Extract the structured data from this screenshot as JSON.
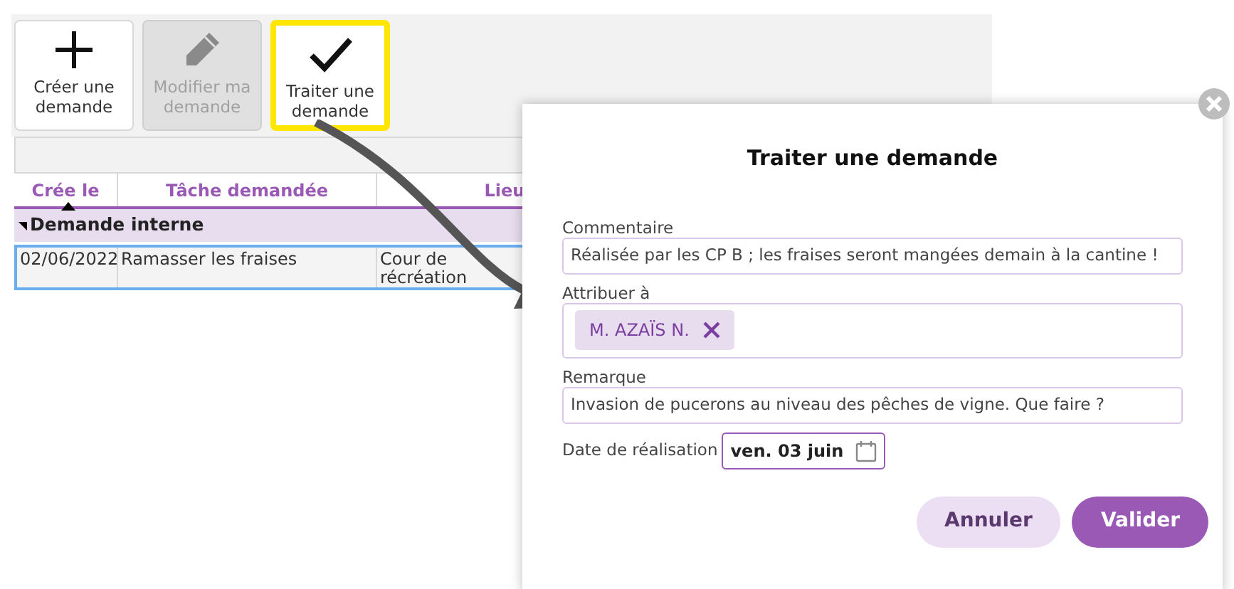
{
  "toolbar": {
    "buttons": [
      {
        "label": "Créer une demande",
        "kind": "plus",
        "disabled": false,
        "highlighted": false
      },
      {
        "label": "Modifier ma demande",
        "kind": "pencil",
        "disabled": true,
        "highlighted": false
      },
      {
        "label": "Traiter une demande",
        "kind": "check",
        "disabled": false,
        "highlighted": true
      }
    ]
  },
  "table": {
    "columns": [
      {
        "label": "Crée le",
        "sorted": true
      },
      {
        "label": "Tâche demandée",
        "sorted": false
      },
      {
        "label": "Lieu",
        "sorted": false
      }
    ],
    "groups": [
      {
        "label": "Demande interne",
        "expanded": true,
        "rows": [
          {
            "cells": [
              "02/06/2022",
              "Ramasser les fraises",
              "Cour de récréation"
            ],
            "selected": true
          }
        ]
      }
    ]
  },
  "dialog": {
    "title": "Traiter une demande",
    "fields": [
      {
        "kind": "text",
        "label": "Commentaire",
        "value": "Réalisée par les CP B ; les fraises seront mangées demain à la cantine !"
      },
      {
        "kind": "tags",
        "label": "Attribuer à",
        "tags": [
          "M. AZAÏS N."
        ]
      },
      {
        "kind": "text",
        "label": "Remarque",
        "value": "Invasion de pucerons au niveau des pêches de vigne. Que faire ?"
      },
      {
        "kind": "date",
        "label": "Date de réalisation",
        "value": "ven. 03 juin"
      }
    ],
    "buttons": [
      {
        "label": "Annuler",
        "primary": false
      },
      {
        "label": "Valider",
        "primary": true
      }
    ]
  }
}
